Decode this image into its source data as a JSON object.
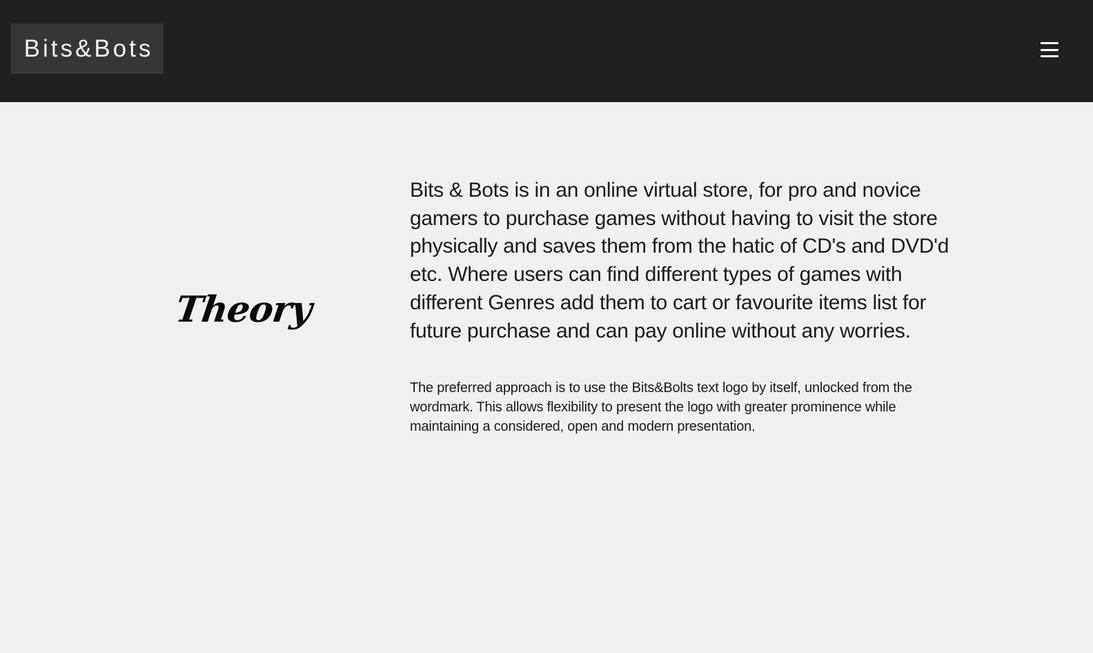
{
  "navbar": {
    "logo_text": "Bits&Bots",
    "menu_icon": "hamburger-menu-icon"
  },
  "section": {
    "heading": "Theory",
    "lead": "Bits & Bots is in an online virtual store, for pro and novice gamers to purchase games without having to visit the store physically and saves them from the hatic of CD's and DVD'd etc. Where users can find different types of games with different Genres add them to cart or favourite items list for future purchase and can pay online without any worries.",
    "body": "The preferred approach is to use the Bits&Bolts text logo by itself, unlocked from the wordmark. This allows flexibility to present the logo with greater prominence while maintaining a considered, open and modern presentation."
  },
  "colors": {
    "navbar_bg": "#221f20",
    "logo_bg": "#363636",
    "page_bg": "#f0f0f0",
    "text": "#1b1b1b"
  }
}
